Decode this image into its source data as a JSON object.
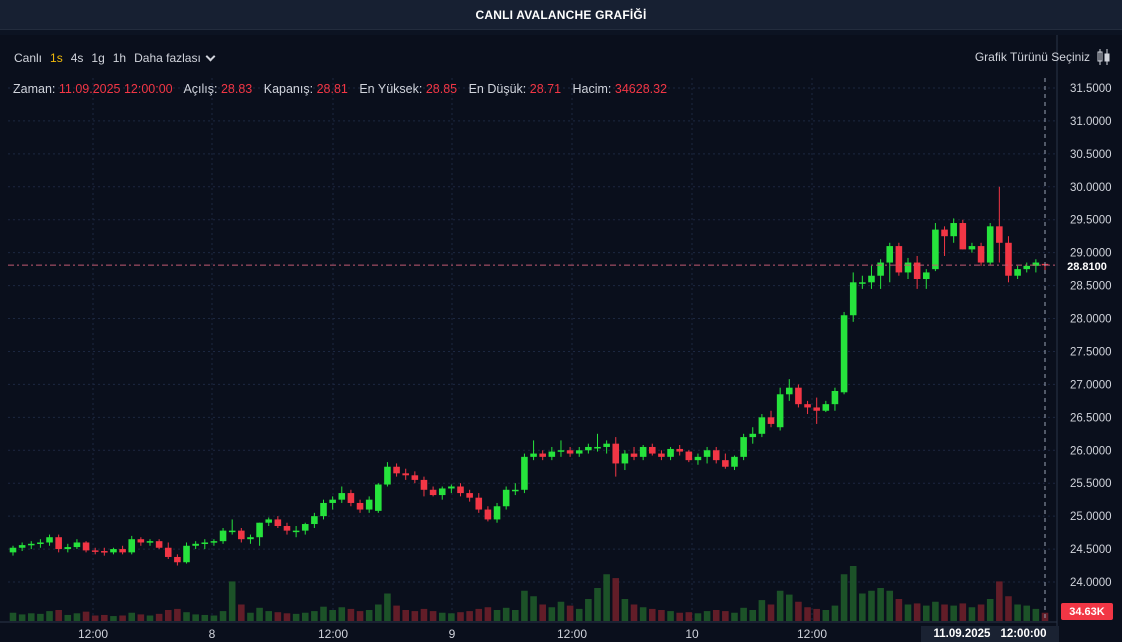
{
  "title": "CANLI AVALANCHE GRAFİĞİ",
  "toolbar": {
    "items": [
      {
        "label": "Canlı",
        "active": false
      },
      {
        "label": "1s",
        "active": true
      },
      {
        "label": "4s",
        "active": false
      },
      {
        "label": "1g",
        "active": false
      },
      {
        "label": "1h",
        "active": false
      }
    ],
    "more_label": "Daha fazlası"
  },
  "chart_type_label": "Grafik Türünü Seçiniz",
  "legend": {
    "time_label": "Zaman:",
    "time_value": "11.09.2025 12:00:00",
    "open_label": "Açılış:",
    "open_value": "28.83",
    "close_label": "Kapanış:",
    "close_value": "28.81",
    "high_label": "En Yüksek:",
    "high_value": "28.85",
    "low_label": "En Düşük:",
    "low_value": "28.71",
    "volume_label": "Hacim:",
    "volume_value": "34628.32"
  },
  "last_price_label": "28.8100",
  "volume_badge_label": "34.63K",
  "crosshair_time": {
    "date": "11.09.2025",
    "time": "12:00:00"
  },
  "colors": {
    "up": "#26e33c",
    "down": "#f23645",
    "grid": "#1c2740",
    "bg": "#0a0f1c"
  },
  "chart_data": {
    "type": "candlestick",
    "y_ticks": [
      "31.5000",
      "31.0000",
      "30.5000",
      "30.0000",
      "29.5000",
      "29.0000",
      "28.5000",
      "28.0000",
      "27.5000",
      "27.0000",
      "26.5000",
      "26.0000",
      "25.5000",
      "25.0000",
      "24.5000",
      "24.0000"
    ],
    "ylim": [
      23.5,
      31.75
    ],
    "x_ticks": [
      "12:00",
      "8",
      "12:00",
      "9",
      "12:00",
      "10",
      "12:00"
    ],
    "candles": [
      [
        24.45,
        24.55,
        24.4,
        24.52,
        15
      ],
      [
        24.52,
        24.6,
        24.47,
        24.56,
        12
      ],
      [
        24.56,
        24.62,
        24.5,
        24.58,
        14
      ],
      [
        24.58,
        24.65,
        24.52,
        24.6,
        13
      ],
      [
        24.6,
        24.72,
        24.55,
        24.68,
        18
      ],
      [
        24.68,
        24.72,
        24.45,
        24.5,
        20
      ],
      [
        24.5,
        24.58,
        24.45,
        24.53,
        11
      ],
      [
        24.53,
        24.65,
        24.5,
        24.6,
        14
      ],
      [
        24.6,
        24.62,
        24.45,
        24.48,
        17
      ],
      [
        24.48,
        24.52,
        24.42,
        24.47,
        10
      ],
      [
        24.47,
        24.52,
        24.4,
        24.45,
        11
      ],
      [
        24.45,
        24.52,
        24.42,
        24.5,
        9
      ],
      [
        24.5,
        24.55,
        24.42,
        24.45,
        10
      ],
      [
        24.45,
        24.7,
        24.42,
        24.65,
        15
      ],
      [
        24.65,
        24.68,
        24.55,
        24.6,
        12
      ],
      [
        24.6,
        24.65,
        24.55,
        24.62,
        10
      ],
      [
        24.62,
        24.65,
        24.5,
        24.52,
        13
      ],
      [
        24.52,
        24.6,
        24.35,
        24.38,
        20
      ],
      [
        24.38,
        24.42,
        24.25,
        24.3,
        22
      ],
      [
        24.3,
        24.6,
        24.28,
        24.55,
        16
      ],
      [
        24.55,
        24.62,
        24.5,
        24.58,
        12
      ],
      [
        24.58,
        24.65,
        24.5,
        24.6,
        11
      ],
      [
        24.6,
        24.65,
        24.55,
        24.62,
        10
      ],
      [
        24.62,
        24.82,
        24.58,
        24.78,
        18
      ],
      [
        24.78,
        24.95,
        24.72,
        24.78,
        72
      ],
      [
        24.78,
        24.82,
        24.6,
        24.65,
        30
      ],
      [
        24.65,
        24.72,
        24.58,
        24.68,
        15
      ],
      [
        24.68,
        24.9,
        24.55,
        24.9,
        24
      ],
      [
        24.9,
        24.98,
        24.85,
        24.95,
        18
      ],
      [
        24.95,
        25.0,
        24.82,
        24.85,
        16
      ],
      [
        24.85,
        24.9,
        24.72,
        24.78,
        14
      ],
      [
        24.78,
        24.85,
        24.68,
        24.78,
        13
      ],
      [
        24.78,
        24.9,
        24.72,
        24.88,
        15
      ],
      [
        24.88,
        25.05,
        24.82,
        25.0,
        18
      ],
      [
        25.0,
        25.25,
        24.95,
        25.2,
        26
      ],
      [
        25.2,
        25.3,
        25.1,
        25.25,
        20
      ],
      [
        25.25,
        25.45,
        25.2,
        25.35,
        25
      ],
      [
        25.35,
        25.4,
        25.15,
        25.2,
        22
      ],
      [
        25.2,
        25.25,
        25.05,
        25.1,
        18
      ],
      [
        25.1,
        25.3,
        25.05,
        25.25,
        20
      ],
      [
        25.08,
        25.5,
        25.05,
        25.48,
        30
      ],
      [
        25.48,
        25.82,
        25.45,
        25.75,
        50
      ],
      [
        25.75,
        25.8,
        25.6,
        25.65,
        28
      ],
      [
        25.65,
        25.72,
        25.55,
        25.62,
        20
      ],
      [
        25.62,
        25.68,
        25.5,
        25.55,
        18
      ],
      [
        25.55,
        25.6,
        25.3,
        25.4,
        22
      ],
      [
        25.4,
        25.45,
        25.3,
        25.32,
        18
      ],
      [
        25.32,
        25.45,
        25.25,
        25.42,
        15
      ],
      [
        25.42,
        25.48,
        25.35,
        25.45,
        14
      ],
      [
        25.45,
        25.5,
        25.3,
        25.35,
        16
      ],
      [
        25.35,
        25.4,
        25.22,
        25.28,
        18
      ],
      [
        25.28,
        25.35,
        25.05,
        25.1,
        22
      ],
      [
        25.1,
        25.15,
        24.92,
        24.95,
        25
      ],
      [
        24.95,
        25.2,
        24.9,
        25.15,
        20
      ],
      [
        25.15,
        25.45,
        25.1,
        25.4,
        24
      ],
      [
        25.4,
        25.5,
        25.32,
        25.4,
        20
      ],
      [
        25.4,
        25.95,
        25.35,
        25.9,
        55
      ],
      [
        25.9,
        26.15,
        25.85,
        25.95,
        45
      ],
      [
        25.95,
        26.0,
        25.85,
        25.9,
        30
      ],
      [
        25.9,
        26.05,
        25.85,
        25.98,
        25
      ],
      [
        25.98,
        26.15,
        25.9,
        26.0,
        35
      ],
      [
        26.0,
        26.05,
        25.9,
        25.95,
        28
      ],
      [
        25.95,
        26.05,
        25.9,
        26.0,
        22
      ],
      [
        26.0,
        26.1,
        25.95,
        26.05,
        40
      ],
      [
        26.05,
        26.25,
        25.98,
        26.05,
        60
      ],
      [
        26.05,
        26.15,
        25.95,
        26.1,
        85
      ],
      [
        26.1,
        26.2,
        25.6,
        25.8,
        78
      ],
      [
        25.8,
        26.0,
        25.7,
        25.95,
        40
      ],
      [
        25.95,
        26.05,
        25.85,
        25.9,
        30
      ],
      [
        25.9,
        26.08,
        25.85,
        26.05,
        25
      ],
      [
        26.05,
        26.1,
        25.92,
        25.95,
        22
      ],
      [
        25.95,
        26.0,
        25.85,
        25.9,
        20
      ],
      [
        25.9,
        26.05,
        25.85,
        26.02,
        18
      ],
      [
        26.02,
        26.08,
        25.92,
        25.98,
        15
      ],
      [
        25.98,
        26.0,
        25.82,
        25.85,
        16
      ],
      [
        25.85,
        25.95,
        25.78,
        25.9,
        14
      ],
      [
        25.9,
        26.05,
        25.8,
        26.0,
        18
      ],
      [
        26.0,
        26.05,
        25.8,
        25.85,
        20
      ],
      [
        25.85,
        25.95,
        25.72,
        25.75,
        18
      ],
      [
        25.75,
        25.92,
        25.7,
        25.9,
        15
      ],
      [
        25.9,
        26.25,
        25.85,
        26.2,
        24
      ],
      [
        26.2,
        26.35,
        26.1,
        26.25,
        20
      ],
      [
        26.25,
        26.55,
        26.2,
        26.5,
        38
      ],
      [
        26.5,
        26.6,
        26.35,
        26.4,
        30
      ],
      [
        26.35,
        26.95,
        26.3,
        26.85,
        55
      ],
      [
        26.85,
        27.08,
        26.75,
        26.95,
        48
      ],
      [
        26.95,
        27.0,
        26.65,
        26.7,
        35
      ],
      [
        26.7,
        26.75,
        26.55,
        26.65,
        25
      ],
      [
        26.65,
        26.8,
        26.4,
        26.6,
        22
      ],
      [
        26.6,
        26.75,
        26.58,
        26.7,
        20
      ],
      [
        26.7,
        26.95,
        26.6,
        26.9,
        28
      ],
      [
        26.88,
        28.1,
        26.85,
        28.05,
        85
      ],
      [
        28.05,
        28.7,
        27.95,
        28.55,
        100
      ],
      [
        28.55,
        28.65,
        28.45,
        28.55,
        50
      ],
      [
        28.55,
        28.8,
        28.45,
        28.65,
        55
      ],
      [
        28.65,
        28.9,
        28.45,
        28.85,
        60
      ],
      [
        28.85,
        29.15,
        28.55,
        29.1,
        55
      ],
      [
        29.1,
        29.15,
        28.65,
        28.7,
        40
      ],
      [
        28.7,
        28.92,
        28.6,
        28.85,
        30
      ],
      [
        28.85,
        28.95,
        28.45,
        28.6,
        32
      ],
      [
        28.6,
        28.75,
        28.45,
        28.7,
        28
      ],
      [
        28.75,
        29.45,
        28.72,
        29.35,
        35
      ],
      [
        29.35,
        29.4,
        28.95,
        29.25,
        30
      ],
      [
        29.25,
        29.52,
        29.15,
        29.45,
        28
      ],
      [
        29.45,
        29.5,
        29.05,
        29.05,
        32
      ],
      [
        29.05,
        29.15,
        29.0,
        29.1,
        25
      ],
      [
        29.1,
        29.15,
        28.8,
        28.85,
        30
      ],
      [
        28.85,
        29.45,
        28.82,
        29.4,
        40
      ],
      [
        29.4,
        30.0,
        28.85,
        29.15,
        72
      ],
      [
        29.15,
        29.25,
        28.55,
        28.65,
        45
      ],
      [
        28.65,
        28.8,
        28.6,
        28.75,
        30
      ],
      [
        28.75,
        28.85,
        28.7,
        28.8,
        28
      ],
      [
        28.8,
        28.9,
        28.7,
        28.85,
        22
      ],
      [
        28.83,
        28.85,
        28.71,
        28.81,
        15
      ]
    ]
  }
}
